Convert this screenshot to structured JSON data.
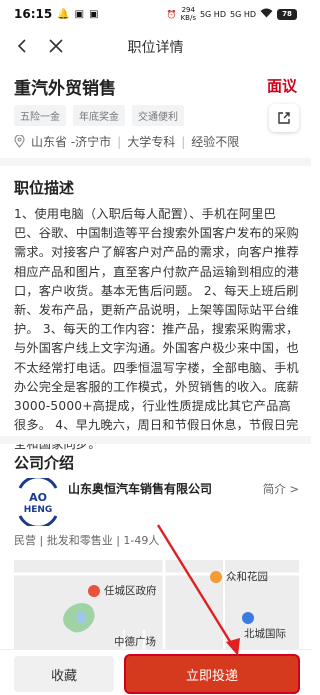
{
  "status_bar": {
    "time": "16:15",
    "net_speed": "294",
    "net_unit": "KB/s",
    "signal_a": "5G HD",
    "signal_b": "5G HD",
    "battery": "78"
  },
  "nav": {
    "title": "职位详情"
  },
  "job": {
    "title": "重汽外贸销售",
    "salary": "面议",
    "tags": [
      "五险一金",
      "年底奖金",
      "交通便利"
    ],
    "location": "山东省 -济宁市",
    "education": "大学专科",
    "experience": "经验不限"
  },
  "description": {
    "heading": "职位描述",
    "text": "1、使用电脑（入职后每人配置）、手机在阿里巴巴、谷歌、中国制造等平台搜索外国客户发布的采购需求。对接客户了解客户对产品的需求，向客户推荐相应产品和图片，直至客户付款产品运输到相应的港口，客户收货。基本无售后问题。 2、每天上班后刷新、发布产品，更新产品说明，上架等国际站平台维护。 3、每天的工作内容：推产品，搜索采购需求，与外国客户线上文字沟通。外国客户极少来中国，也不太经常打电话。四季恒温写字楼，全部电脑、手机办公完全是客服的工作模式，外贸销售的收入。底薪3000-5000+高提成，行业性质提成比其它产品高很多。 4、早九晚六，周日和节假日休息，节假日完全和国家同步。"
  },
  "company": {
    "heading": "公司介绍",
    "logo_text_top": "AO",
    "logo_text_bottom": "HENG",
    "name": "山东奥恒汽车销售有限公司",
    "more": "简介 >",
    "meta": "民营 | 批发和零售业 | 1-49人"
  },
  "map": {
    "labels": [
      "任城区政府",
      "众和花园",
      "中德广场",
      "北城国际"
    ]
  },
  "actions": {
    "favorite": "收藏",
    "apply": "立即投递"
  },
  "colors": {
    "accent_red": "#d0021b",
    "apply_bg": "#d63a1e",
    "tag_bg": "#f2f3f5"
  }
}
